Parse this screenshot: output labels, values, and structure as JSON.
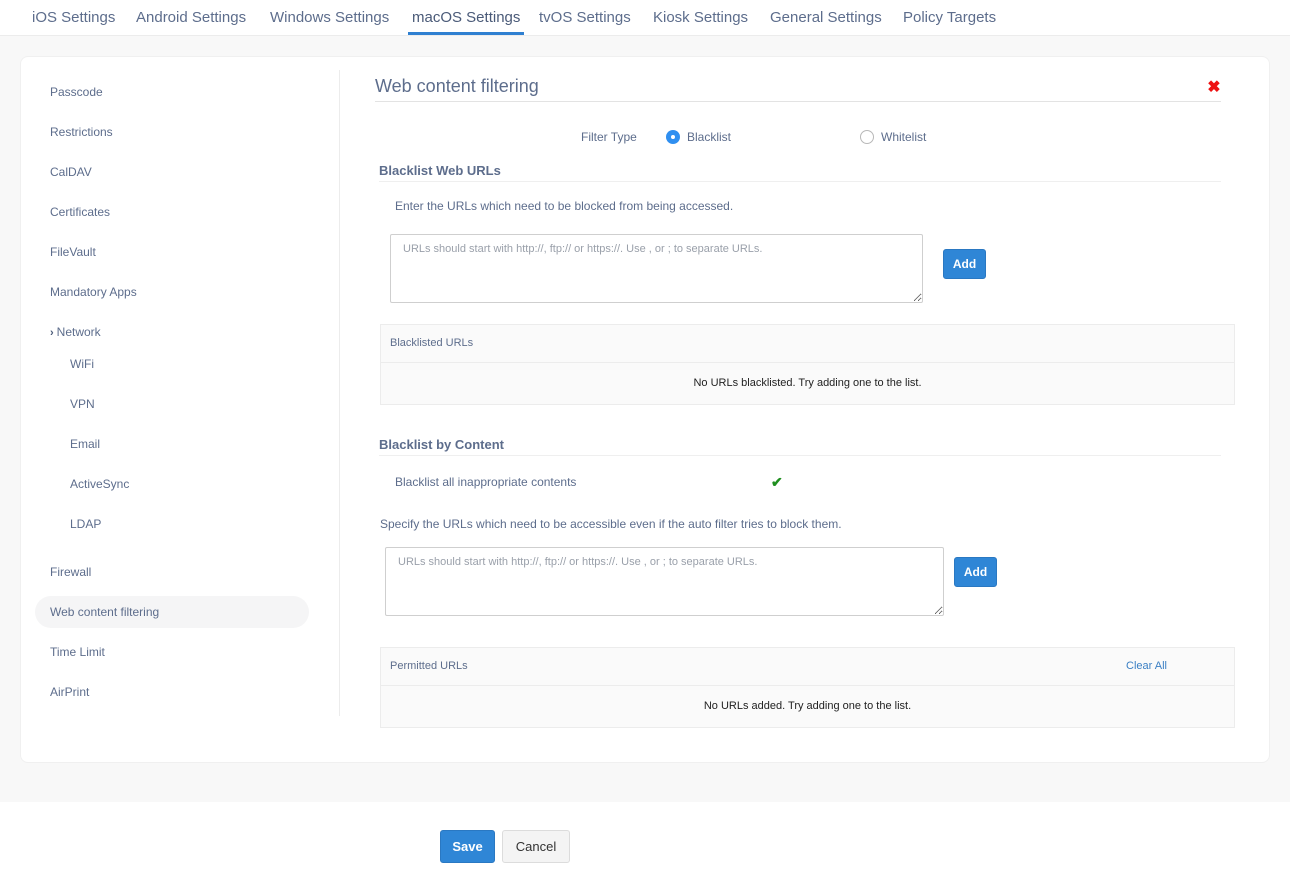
{
  "top_tabs": [
    {
      "label": "iOS Settings",
      "active": false
    },
    {
      "label": "Android Settings",
      "active": false
    },
    {
      "label": "Windows Settings",
      "active": false
    },
    {
      "label": "macOS Settings",
      "active": true
    },
    {
      "label": "tvOS Settings",
      "active": false
    },
    {
      "label": "Kiosk Settings",
      "active": false
    },
    {
      "label": "General Settings",
      "active": false
    },
    {
      "label": "Policy Targets",
      "active": false
    }
  ],
  "sidebar": {
    "items": [
      {
        "label": "Passcode"
      },
      {
        "label": "Restrictions"
      },
      {
        "label": "CalDAV"
      },
      {
        "label": "Certificates"
      },
      {
        "label": "FileVault"
      },
      {
        "label": "Mandatory Apps"
      },
      {
        "label": "Network",
        "expanded": true,
        "icon": "chevron-right-icon"
      },
      {
        "label": "WiFi",
        "sub": true
      },
      {
        "label": "VPN",
        "sub": true
      },
      {
        "label": "Email",
        "sub": true
      },
      {
        "label": "ActiveSync",
        "sub": true
      },
      {
        "label": "LDAP",
        "sub": true
      },
      {
        "label": "Firewall"
      },
      {
        "label": "Web content filtering",
        "active": true
      },
      {
        "label": "Time Limit"
      },
      {
        "label": "AirPrint"
      }
    ]
  },
  "main": {
    "title": "Web content filtering",
    "close_icon": "close-icon",
    "filter_type": {
      "label": "Filter Type",
      "options": [
        "Blacklist",
        "Whitelist"
      ],
      "selected": "Blacklist"
    },
    "blacklist_urls": {
      "heading": "Blacklist Web URLs",
      "description": "Enter the URLs which need to be blocked from being accessed.",
      "input_placeholder": "URLs should start with http://, ftp:// or https://. Use , or ; to separate URLs.",
      "input_value": "",
      "add_label": "Add",
      "table_header": "Blacklisted URLs",
      "empty_message": "No URLs blacklisted. Try adding one to the list."
    },
    "blacklist_content": {
      "heading": "Blacklist by Content",
      "option_label": "Blacklist all inappropriate contents",
      "option_checked": true,
      "description": "Specify the URLs which need to be accessible even if the auto filter tries to block them.",
      "input_placeholder": "URLs should start with http://, ftp:// or https://. Use , or ; to separate URLs.",
      "input_value": "",
      "add_label": "Add",
      "table_header": "Permitted URLs",
      "clear_all_label": "Clear All",
      "empty_message": "No URLs added. Try adding one to the list."
    }
  },
  "footer": {
    "save_label": "Save",
    "cancel_label": "Cancel"
  },
  "colors": {
    "accent": "#2f86d6",
    "close": "#ee1111",
    "check": "#1f8f1f",
    "text": "#5d6d8c"
  }
}
